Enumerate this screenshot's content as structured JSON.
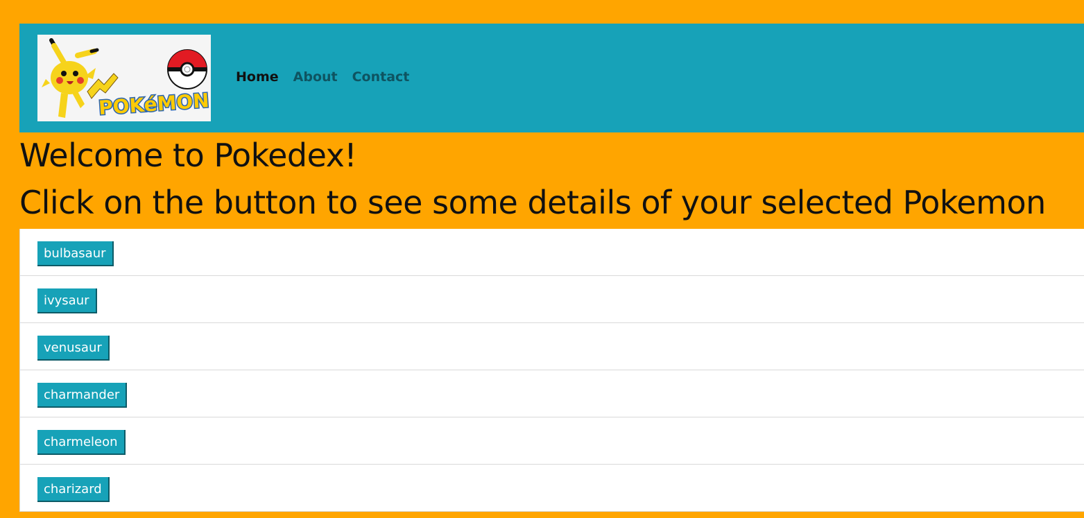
{
  "header": {
    "logo_text": "POKéMON",
    "nav": [
      {
        "label": "Home",
        "active": true
      },
      {
        "label": "About",
        "active": false
      },
      {
        "label": "Contact",
        "active": false
      }
    ]
  },
  "main": {
    "title": "Welcome to Pokedex!",
    "subtitle": "Click on the button to see some details of your selected Pokemon"
  },
  "pokemon_list": [
    {
      "name": "bulbasaur"
    },
    {
      "name": "ivysaur"
    },
    {
      "name": "venusaur"
    },
    {
      "name": "charmander"
    },
    {
      "name": "charmeleon"
    },
    {
      "name": "charizard"
    }
  ],
  "colors": {
    "page_bg": "#ffa500",
    "navbar_bg": "#17a2b8",
    "button_bg": "#17a2b8"
  }
}
